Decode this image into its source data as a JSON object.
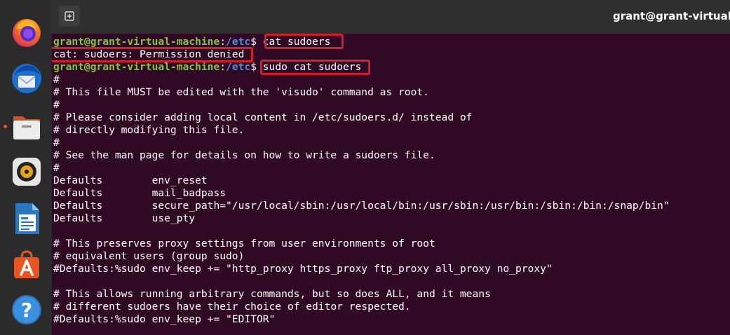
{
  "window": {
    "title": "grant@grant-virtual-ma"
  },
  "dock": {
    "items": [
      {
        "name": "firefox",
        "icon": "firefox-icon"
      },
      {
        "name": "thunderbird",
        "icon": "thunderbird-icon"
      },
      {
        "name": "files",
        "icon": "files-icon",
        "running": true
      },
      {
        "name": "rhythmbox",
        "icon": "rhythmbox-icon"
      },
      {
        "name": "libreoffice-writer",
        "icon": "writer-icon"
      },
      {
        "name": "ubuntu-software",
        "icon": "software-icon"
      },
      {
        "name": "help",
        "icon": "help-icon"
      }
    ]
  },
  "terminal": {
    "prompt1": {
      "user": "grant@grant-virtual-machine",
      "colon": ":",
      "path": "/etc",
      "dollar": "$ ",
      "command": "cat sudoers"
    },
    "error": "cat: sudoers: Permission denied",
    "prompt2": {
      "user": "grant@grant-virtual-machine",
      "colon": ":",
      "path": "/etc",
      "dollar": "$ ",
      "command": "sudo cat sudoers"
    },
    "output": [
      "#",
      "# This file MUST be edited with the 'visudo' command as root.",
      "#",
      "# Please consider adding local content in /etc/sudoers.d/ instead of",
      "# directly modifying this file.",
      "#",
      "# See the man page for details on how to write a sudoers file.",
      "#",
      "Defaults        env_reset",
      "Defaults        mail_badpass",
      "Defaults        secure_path=\"/usr/local/sbin:/usr/local/bin:/usr/sbin:/usr/bin:/sbin:/bin:/snap/bin\"",
      "Defaults        use_pty",
      "",
      "# This preserves proxy settings from user environments of root",
      "# equivalent users (group sudo)",
      "#Defaults:%sudo env_keep += \"http_proxy https_proxy ftp_proxy all_proxy no_proxy\"",
      "",
      "# This allows running arbitrary commands, but so does ALL, and it means",
      "# different sudoers have their choice of editor respected.",
      "#Defaults:%sudo env_keep += \"EDITOR\""
    ]
  },
  "colors": {
    "terminal_bg": "#300a24",
    "prompt_user": "#7ec742",
    "prompt_path": "#4e8ed6",
    "highlight": "#d01f2a",
    "accent": "#e95420"
  }
}
